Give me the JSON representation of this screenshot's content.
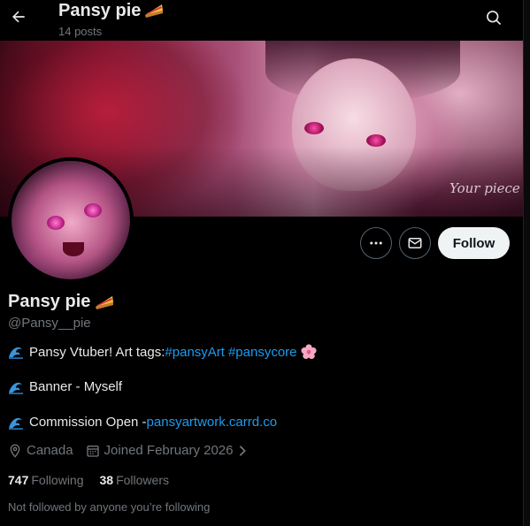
{
  "header": {
    "title": "Pansy pie",
    "post_count": "14 posts"
  },
  "banner": {
    "watermark": "Your piece"
  },
  "actions": {
    "more_icon": "more-icon",
    "message_icon": "envelope-icon",
    "follow_label": "Follow"
  },
  "profile": {
    "name": "Pansy pie",
    "handle": "@Pansy__pie",
    "bio": [
      {
        "prefix": "Pansy Vtuber! Art tags: ",
        "tag1": "#pansyArt",
        "tag2": "#pansycore"
      },
      {
        "text": "Banner - Myself"
      },
      {
        "prefix": "Commission Open - ",
        "link": "pansyartwork.carrd.co"
      }
    ],
    "location": "Canada",
    "joined": "Joined February 2026",
    "following_count": "747",
    "following_label": "Following",
    "followers_count": "38",
    "followers_label": "Followers",
    "not_followed": "Not followed by anyone you’re following"
  },
  "colors": {
    "accent": "#1d9bf0",
    "muted": "#71767b",
    "text": "#e7e9ea",
    "background": "#000000"
  }
}
